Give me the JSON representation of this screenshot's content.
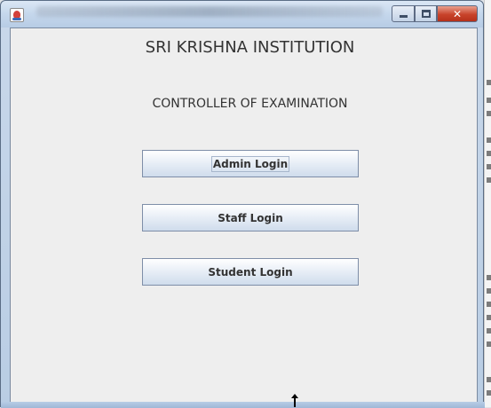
{
  "window": {
    "controls": {
      "minimize_icon": "minimize-icon",
      "maximize_icon": "maximize-icon",
      "close_icon": "close-icon",
      "close_glyph": "✕"
    }
  },
  "content": {
    "title": "SRI KRISHNA INSTITUTION",
    "subtitle": "CONTROLLER OF EXAMINATION"
  },
  "buttons": {
    "admin_login": "Admin Login",
    "staff_login": "Staff Login",
    "student_login": "Student Login"
  },
  "colors": {
    "close_button": "#c8432b",
    "content_bg": "#eeeeee"
  }
}
